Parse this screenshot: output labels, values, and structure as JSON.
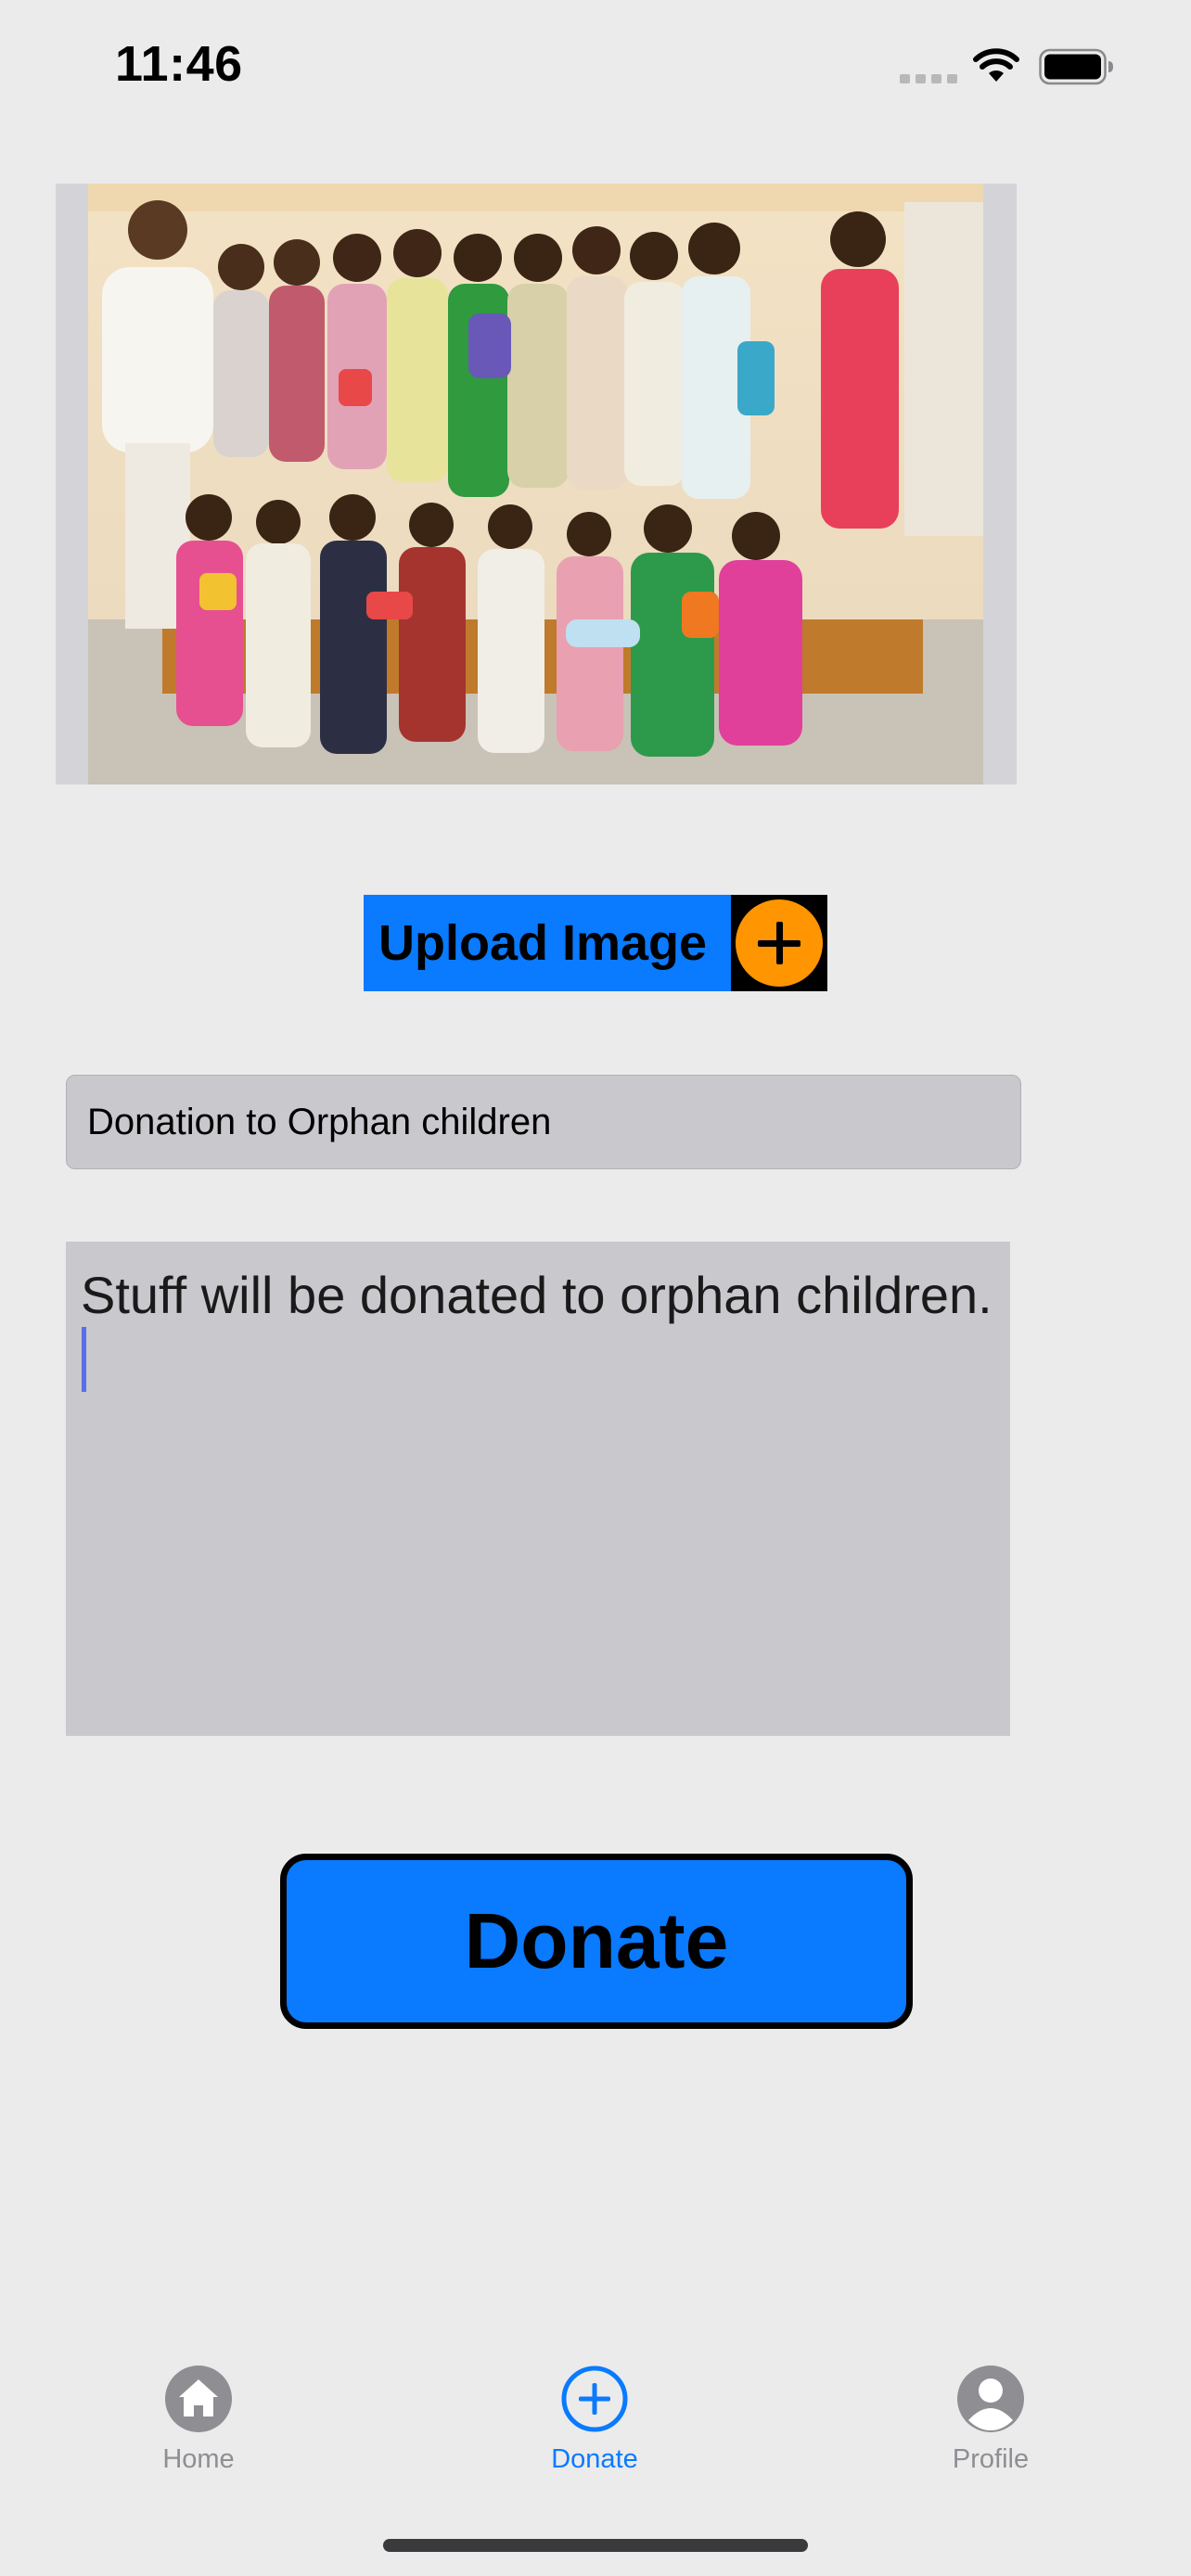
{
  "status_bar": {
    "time": "11:46"
  },
  "photo": {
    "description_alt": "Group photo of children holding donated toys"
  },
  "upload": {
    "label": "Upload Image",
    "icon": "plus-circle-icon",
    "colors": {
      "button": "#0a7aff",
      "icon_bg": "#ff9500"
    }
  },
  "form": {
    "title_value": "Donation to Orphan children",
    "description_value": "Stuff will be donated to orphan children."
  },
  "donate_button": {
    "label": "Donate",
    "color": "#0a7aff"
  },
  "tab_bar": {
    "items": [
      {
        "label": "Home",
        "icon": "house-icon",
        "active": false
      },
      {
        "label": "Donate",
        "icon": "plus-circle-icon",
        "active": true
      },
      {
        "label": "Profile",
        "icon": "person-circle-icon",
        "active": false
      }
    ],
    "active_color": "#0a7aff",
    "inactive_color": "#8e8e93"
  }
}
